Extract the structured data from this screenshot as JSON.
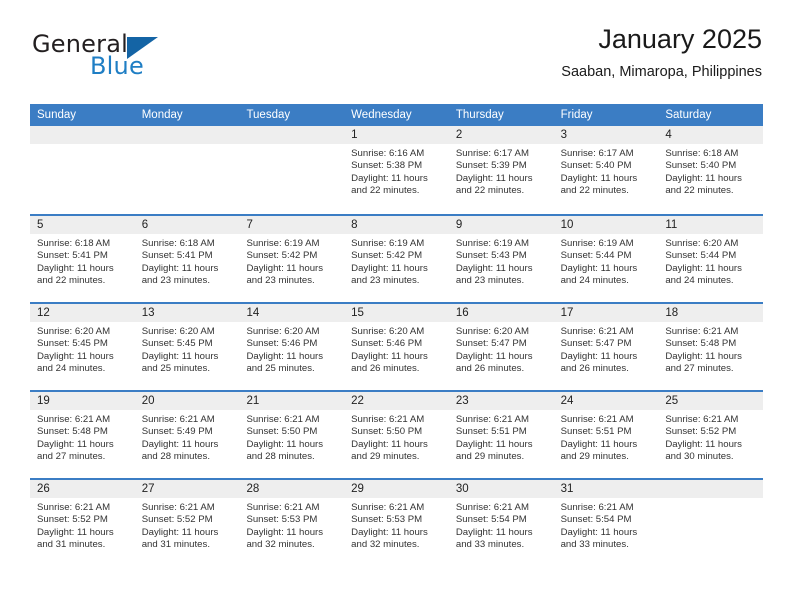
{
  "brand": {
    "name_part1": "General",
    "name_part2": "Blue",
    "logo_icon": "triangle-logo-icon"
  },
  "header": {
    "month_title": "January 2025",
    "location": "Saaban, Mimaropa, Philippines"
  },
  "colors": {
    "header_blue": "#3b7dc4",
    "brand_blue": "#1f7ec4",
    "logo_blue": "#1464a5",
    "day_band_gray": "#eeeeee"
  },
  "weekdays": [
    "Sunday",
    "Monday",
    "Tuesday",
    "Wednesday",
    "Thursday",
    "Friday",
    "Saturday"
  ],
  "weeks": [
    [
      {
        "day": "",
        "sunrise": "",
        "sunset": "",
        "daylight_line1": "",
        "daylight_line2": ""
      },
      {
        "day": "",
        "sunrise": "",
        "sunset": "",
        "daylight_line1": "",
        "daylight_line2": ""
      },
      {
        "day": "",
        "sunrise": "",
        "sunset": "",
        "daylight_line1": "",
        "daylight_line2": ""
      },
      {
        "day": "1",
        "sunrise": "Sunrise: 6:16 AM",
        "sunset": "Sunset: 5:38 PM",
        "daylight_line1": "Daylight: 11 hours",
        "daylight_line2": "and 22 minutes."
      },
      {
        "day": "2",
        "sunrise": "Sunrise: 6:17 AM",
        "sunset": "Sunset: 5:39 PM",
        "daylight_line1": "Daylight: 11 hours",
        "daylight_line2": "and 22 minutes."
      },
      {
        "day": "3",
        "sunrise": "Sunrise: 6:17 AM",
        "sunset": "Sunset: 5:40 PM",
        "daylight_line1": "Daylight: 11 hours",
        "daylight_line2": "and 22 minutes."
      },
      {
        "day": "4",
        "sunrise": "Sunrise: 6:18 AM",
        "sunset": "Sunset: 5:40 PM",
        "daylight_line1": "Daylight: 11 hours",
        "daylight_line2": "and 22 minutes."
      }
    ],
    [
      {
        "day": "5",
        "sunrise": "Sunrise: 6:18 AM",
        "sunset": "Sunset: 5:41 PM",
        "daylight_line1": "Daylight: 11 hours",
        "daylight_line2": "and 22 minutes."
      },
      {
        "day": "6",
        "sunrise": "Sunrise: 6:18 AM",
        "sunset": "Sunset: 5:41 PM",
        "daylight_line1": "Daylight: 11 hours",
        "daylight_line2": "and 23 minutes."
      },
      {
        "day": "7",
        "sunrise": "Sunrise: 6:19 AM",
        "sunset": "Sunset: 5:42 PM",
        "daylight_line1": "Daylight: 11 hours",
        "daylight_line2": "and 23 minutes."
      },
      {
        "day": "8",
        "sunrise": "Sunrise: 6:19 AM",
        "sunset": "Sunset: 5:42 PM",
        "daylight_line1": "Daylight: 11 hours",
        "daylight_line2": "and 23 minutes."
      },
      {
        "day": "9",
        "sunrise": "Sunrise: 6:19 AM",
        "sunset": "Sunset: 5:43 PM",
        "daylight_line1": "Daylight: 11 hours",
        "daylight_line2": "and 23 minutes."
      },
      {
        "day": "10",
        "sunrise": "Sunrise: 6:19 AM",
        "sunset": "Sunset: 5:44 PM",
        "daylight_line1": "Daylight: 11 hours",
        "daylight_line2": "and 24 minutes."
      },
      {
        "day": "11",
        "sunrise": "Sunrise: 6:20 AM",
        "sunset": "Sunset: 5:44 PM",
        "daylight_line1": "Daylight: 11 hours",
        "daylight_line2": "and 24 minutes."
      }
    ],
    [
      {
        "day": "12",
        "sunrise": "Sunrise: 6:20 AM",
        "sunset": "Sunset: 5:45 PM",
        "daylight_line1": "Daylight: 11 hours",
        "daylight_line2": "and 24 minutes."
      },
      {
        "day": "13",
        "sunrise": "Sunrise: 6:20 AM",
        "sunset": "Sunset: 5:45 PM",
        "daylight_line1": "Daylight: 11 hours",
        "daylight_line2": "and 25 minutes."
      },
      {
        "day": "14",
        "sunrise": "Sunrise: 6:20 AM",
        "sunset": "Sunset: 5:46 PM",
        "daylight_line1": "Daylight: 11 hours",
        "daylight_line2": "and 25 minutes."
      },
      {
        "day": "15",
        "sunrise": "Sunrise: 6:20 AM",
        "sunset": "Sunset: 5:46 PM",
        "daylight_line1": "Daylight: 11 hours",
        "daylight_line2": "and 26 minutes."
      },
      {
        "day": "16",
        "sunrise": "Sunrise: 6:20 AM",
        "sunset": "Sunset: 5:47 PM",
        "daylight_line1": "Daylight: 11 hours",
        "daylight_line2": "and 26 minutes."
      },
      {
        "day": "17",
        "sunrise": "Sunrise: 6:21 AM",
        "sunset": "Sunset: 5:47 PM",
        "daylight_line1": "Daylight: 11 hours",
        "daylight_line2": "and 26 minutes."
      },
      {
        "day": "18",
        "sunrise": "Sunrise: 6:21 AM",
        "sunset": "Sunset: 5:48 PM",
        "daylight_line1": "Daylight: 11 hours",
        "daylight_line2": "and 27 minutes."
      }
    ],
    [
      {
        "day": "19",
        "sunrise": "Sunrise: 6:21 AM",
        "sunset": "Sunset: 5:48 PM",
        "daylight_line1": "Daylight: 11 hours",
        "daylight_line2": "and 27 minutes."
      },
      {
        "day": "20",
        "sunrise": "Sunrise: 6:21 AM",
        "sunset": "Sunset: 5:49 PM",
        "daylight_line1": "Daylight: 11 hours",
        "daylight_line2": "and 28 minutes."
      },
      {
        "day": "21",
        "sunrise": "Sunrise: 6:21 AM",
        "sunset": "Sunset: 5:50 PM",
        "daylight_line1": "Daylight: 11 hours",
        "daylight_line2": "and 28 minutes."
      },
      {
        "day": "22",
        "sunrise": "Sunrise: 6:21 AM",
        "sunset": "Sunset: 5:50 PM",
        "daylight_line1": "Daylight: 11 hours",
        "daylight_line2": "and 29 minutes."
      },
      {
        "day": "23",
        "sunrise": "Sunrise: 6:21 AM",
        "sunset": "Sunset: 5:51 PM",
        "daylight_line1": "Daylight: 11 hours",
        "daylight_line2": "and 29 minutes."
      },
      {
        "day": "24",
        "sunrise": "Sunrise: 6:21 AM",
        "sunset": "Sunset: 5:51 PM",
        "daylight_line1": "Daylight: 11 hours",
        "daylight_line2": "and 29 minutes."
      },
      {
        "day": "25",
        "sunrise": "Sunrise: 6:21 AM",
        "sunset": "Sunset: 5:52 PM",
        "daylight_line1": "Daylight: 11 hours",
        "daylight_line2": "and 30 minutes."
      }
    ],
    [
      {
        "day": "26",
        "sunrise": "Sunrise: 6:21 AM",
        "sunset": "Sunset: 5:52 PM",
        "daylight_line1": "Daylight: 11 hours",
        "daylight_line2": "and 31 minutes."
      },
      {
        "day": "27",
        "sunrise": "Sunrise: 6:21 AM",
        "sunset": "Sunset: 5:52 PM",
        "daylight_line1": "Daylight: 11 hours",
        "daylight_line2": "and 31 minutes."
      },
      {
        "day": "28",
        "sunrise": "Sunrise: 6:21 AM",
        "sunset": "Sunset: 5:53 PM",
        "daylight_line1": "Daylight: 11 hours",
        "daylight_line2": "and 32 minutes."
      },
      {
        "day": "29",
        "sunrise": "Sunrise: 6:21 AM",
        "sunset": "Sunset: 5:53 PM",
        "daylight_line1": "Daylight: 11 hours",
        "daylight_line2": "and 32 minutes."
      },
      {
        "day": "30",
        "sunrise": "Sunrise: 6:21 AM",
        "sunset": "Sunset: 5:54 PM",
        "daylight_line1": "Daylight: 11 hours",
        "daylight_line2": "and 33 minutes."
      },
      {
        "day": "31",
        "sunrise": "Sunrise: 6:21 AM",
        "sunset": "Sunset: 5:54 PM",
        "daylight_line1": "Daylight: 11 hours",
        "daylight_line2": "and 33 minutes."
      },
      {
        "day": "",
        "sunrise": "",
        "sunset": "",
        "daylight_line1": "",
        "daylight_line2": ""
      }
    ]
  ]
}
